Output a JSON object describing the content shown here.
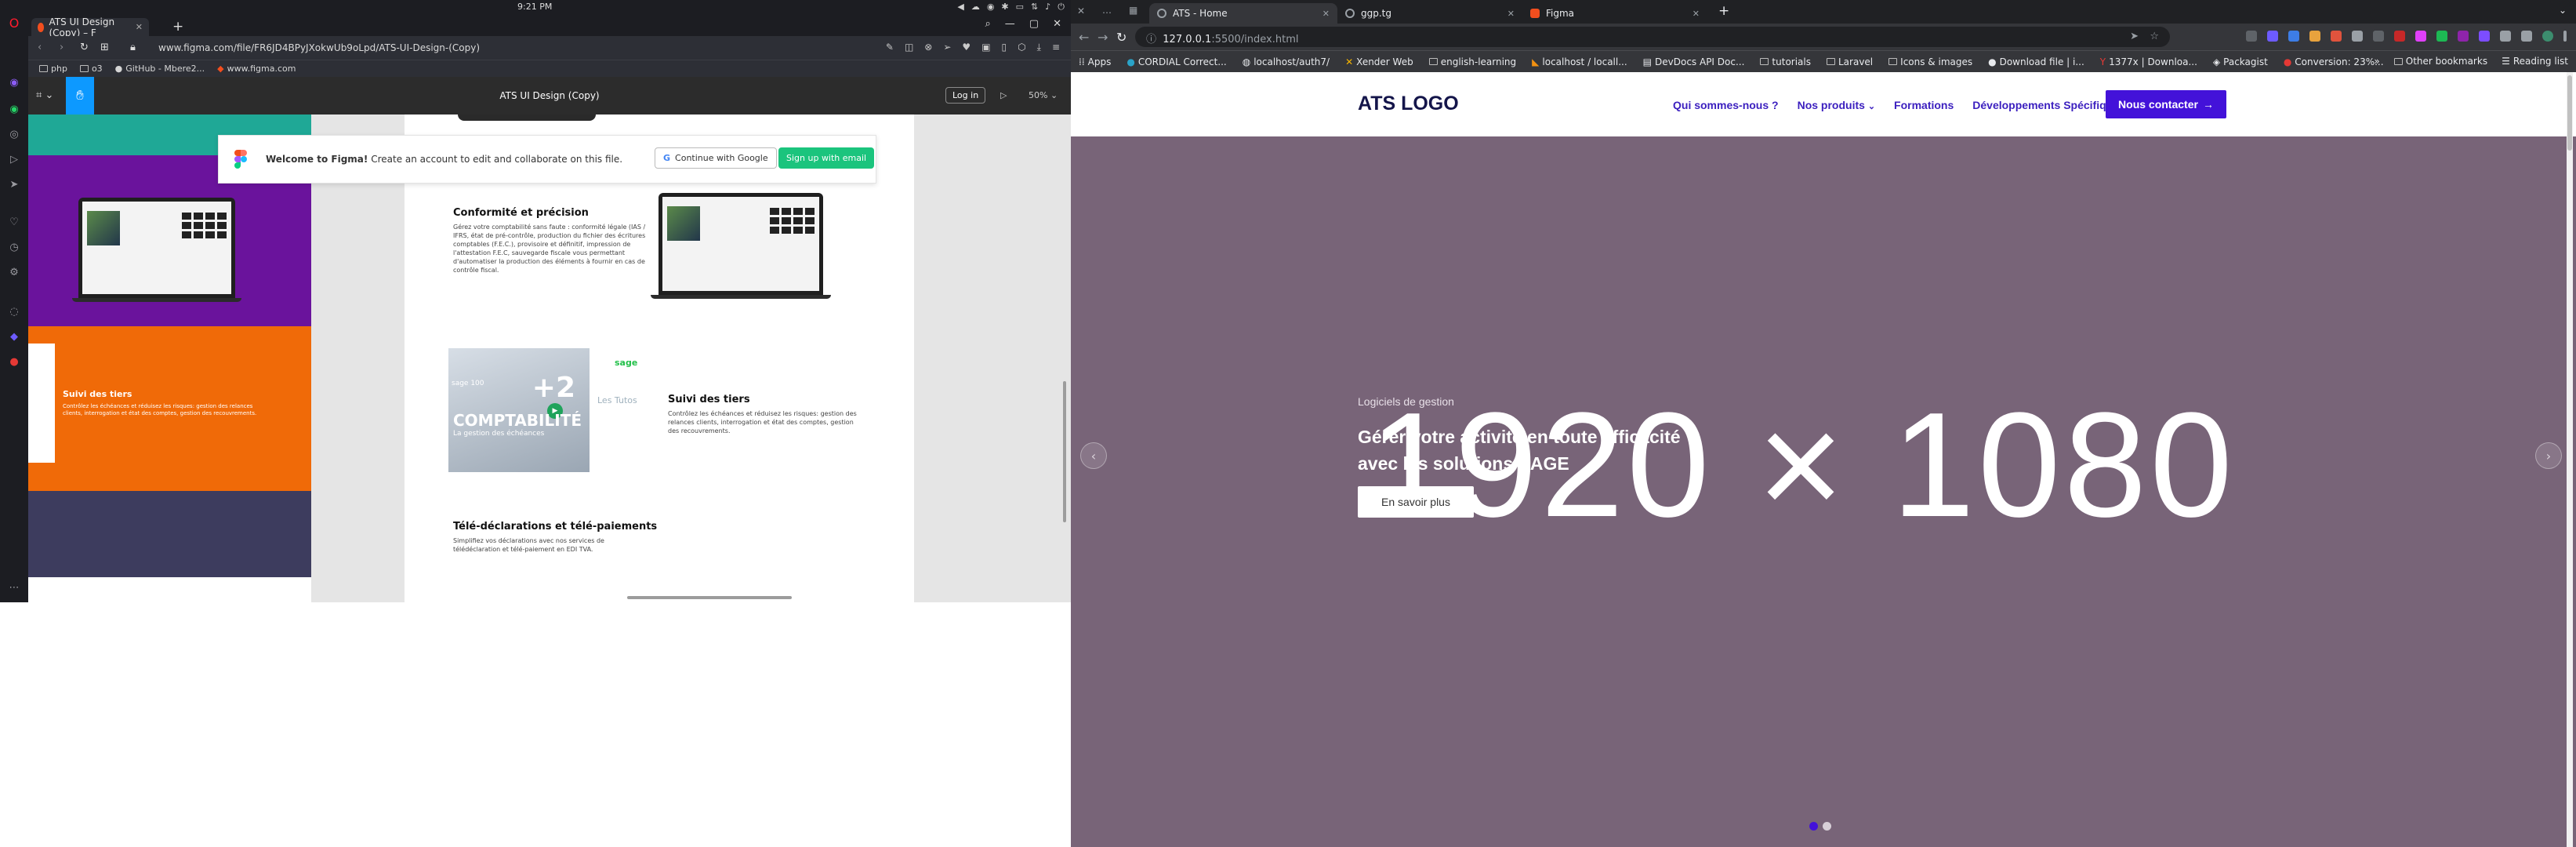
{
  "opera": {
    "clock": "9:21 PM",
    "tab_title": "ATS UI Design (Copy) – F",
    "url": "www.figma.com/file/FR6JD4BPyJXokwUb9oLpd/ATS-UI-Design-(Copy)",
    "bookmarks": [
      "php",
      "o3",
      "GitHub - Mbere2...",
      "www.figma.com"
    ]
  },
  "figma": {
    "file_name": "ATS UI Design (Copy)",
    "login_label": "Log in",
    "zoom": "50%",
    "banner": {
      "title": "Welcome to Figma!",
      "text": "Create an account to edit and collaborate on this file.",
      "google_btn": "Continue with Google",
      "email_btn": "Sign up with email"
    },
    "sections": {
      "conformite_title": "Conformité et précision",
      "conformite_text": "Gérez votre comptabilité sans faute : conformité légale (IAS / IFRS, état de pré-contrôle, production du fichier des écritures comptables (F.E.C.), provisoire et définitif, impression de l'attestation F.E.C, sauvegarde fiscale vous permettant d'automatiser la production des éléments à fournir en cas de contrôle fiscal.",
      "tiers_title": "Suivi des tiers",
      "tiers_text": "Contrôlez les échéances et réduisez les risques: gestion des relances clients, interrogation et état des comptes, gestion des recouvrements.",
      "orange_title": "Suivi des tiers",
      "orange_text": "Contrôlez les échéances et réduisez les risques: gestion des relances clients, interrogation et état des comptes, gestion des recouvrements.",
      "teledecl_title": "Télé-déclarations et télé-paiements",
      "teledecl_text": "Simplifiez vos déclarations avec nos services de télédéclaration et télé-paiement en EDI TVA.",
      "video_big": "COMPTABILITÉ",
      "video_sub": "La gestion des échéances",
      "video_num": "+2",
      "video_sage": "sage 100",
      "sage_logo": "sage",
      "les_tutos": "Les Tutos"
    }
  },
  "chrome": {
    "tabs": [
      {
        "title": "ATS - Home",
        "active": true
      },
      {
        "title": "ggp.tg",
        "active": false
      },
      {
        "title": "Figma",
        "active": false
      }
    ],
    "url_host": "127.0.0.1",
    "url_path": ":5500/index.html",
    "bookmarks": [
      "Apps",
      "CORDIAL Correct...",
      "localhost/auth7/",
      "Xender Web",
      "english-learning",
      "localhost / locall...",
      "DevDocs API Doc...",
      "tutorials",
      "Laravel",
      "Icons & images",
      "Download file | i...",
      "1377x | Downloa...",
      "Packagist",
      "Conversion: 23%..."
    ],
    "bookmarks_right": [
      "Other bookmarks",
      "Reading list"
    ]
  },
  "site": {
    "logo": "ATS LOGO",
    "menu": [
      "Qui sommes-nous ?",
      "Nos produits",
      "Formations",
      "Développements Spécifiques"
    ],
    "cta": "Nous contacter",
    "hero": {
      "placeholder": "1920 × 1080",
      "eyebrow": "Logiciels de gestion",
      "title": "Gérer votre activité en toute efficacité avec les solutions SAGE",
      "button": "En savoir plus",
      "slide_count": 2,
      "active_slide": 1
    },
    "colors": {
      "accent": "#4312d9",
      "hero_bg": "#786478",
      "logo": "#14154a"
    }
  }
}
